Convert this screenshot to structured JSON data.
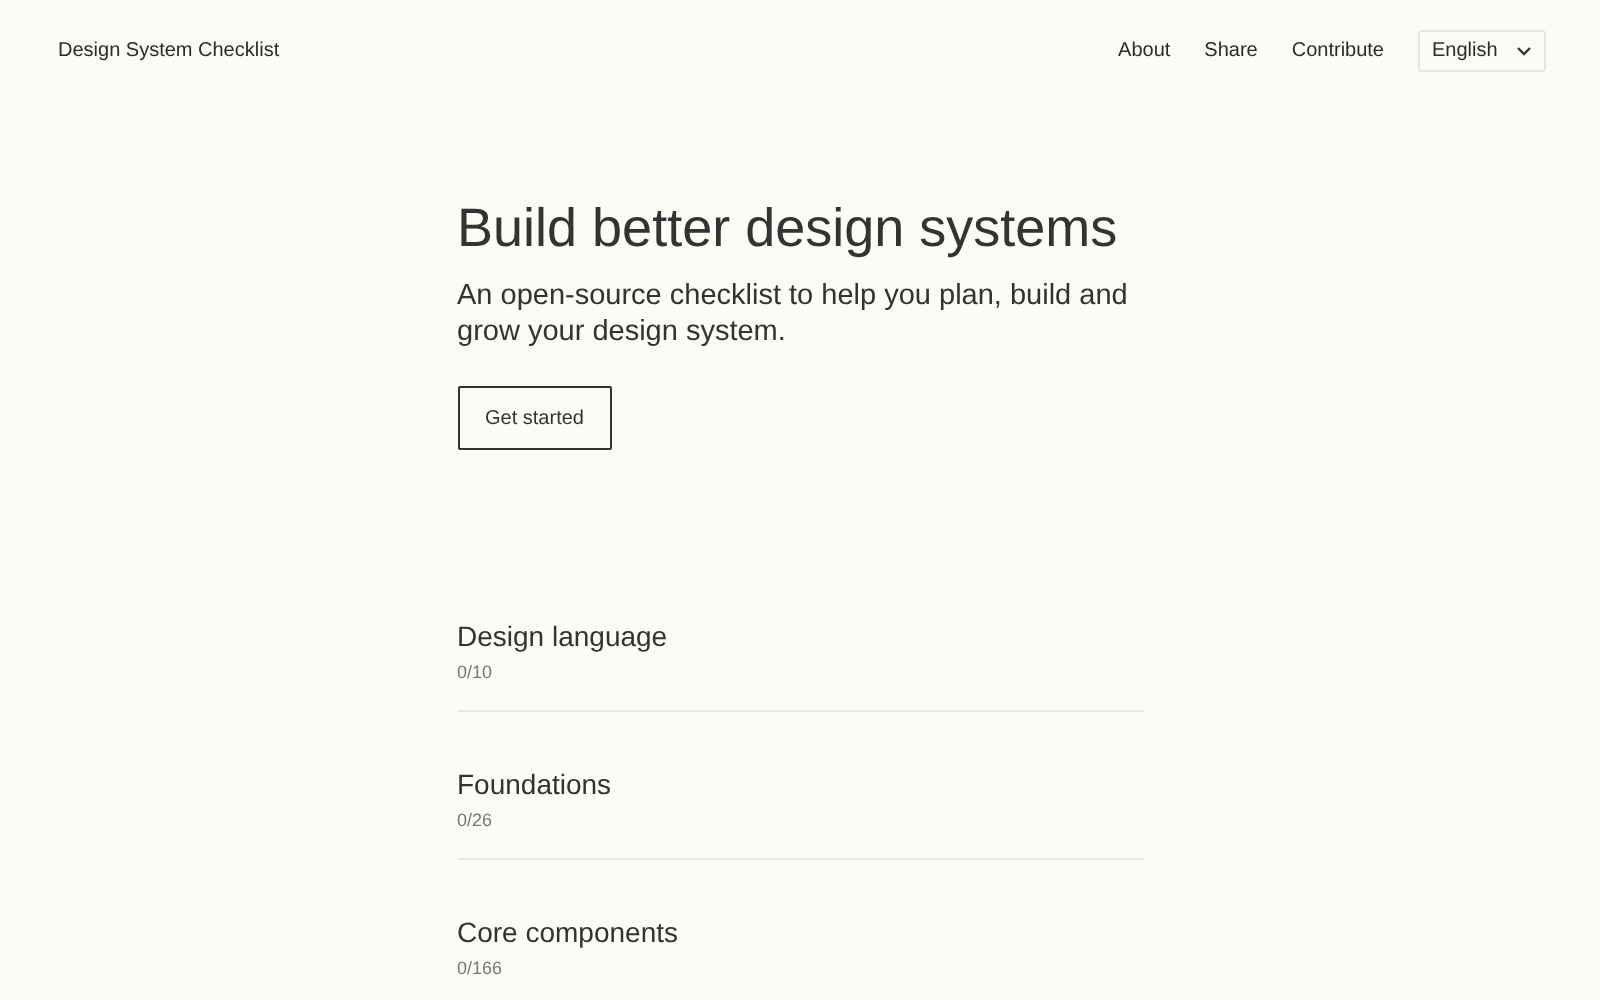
{
  "header": {
    "site_title": "Design System Checklist",
    "nav_links": [
      "About",
      "Share",
      "Contribute"
    ],
    "language_select": {
      "value": "English"
    }
  },
  "hero": {
    "title": "Build better design systems",
    "subtitle": "An open-source checklist to help you plan, build and grow your design system.",
    "button": "Get started"
  },
  "sections": [
    {
      "title": "Design language",
      "count": "0/10"
    },
    {
      "title": "Foundations",
      "count": "0/26"
    },
    {
      "title": "Core components",
      "count": "0/166"
    }
  ]
}
